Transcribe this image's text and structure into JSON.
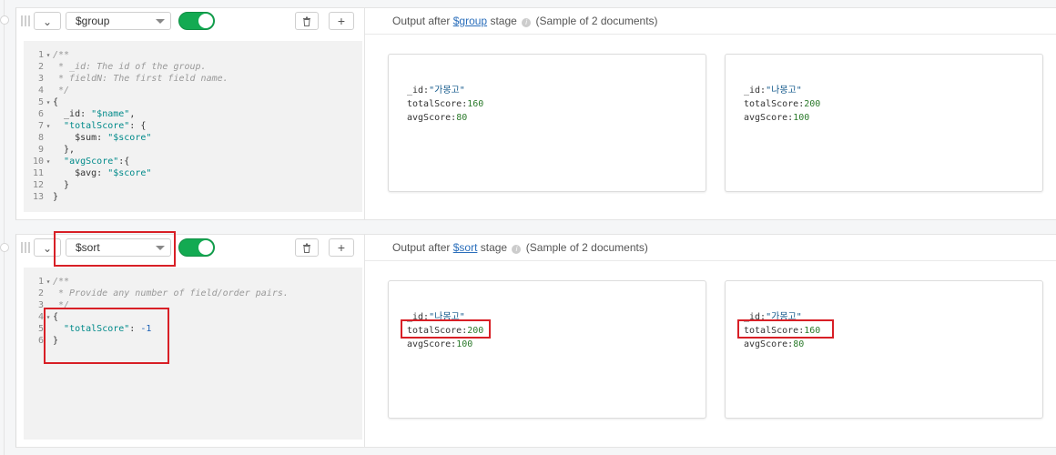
{
  "stages": [
    {
      "operator": "$group",
      "enabled": true,
      "collapse_icon": "chevron-down-icon",
      "delete_icon": "trash-icon",
      "add_label": "+",
      "output_header": {
        "prefix": "Output after",
        "link": "$group",
        "suffix": "stage",
        "sample": "(Sample of 2 documents)"
      },
      "code": [
        {
          "n": "1",
          "fold": true,
          "text": "/**",
          "type": "comment"
        },
        {
          "n": "2",
          "text": " * _id: The id of the group.",
          "type": "comment"
        },
        {
          "n": "3",
          "text": " * fieldN: The first field name.",
          "type": "comment"
        },
        {
          "n": "4",
          "text": " */",
          "type": "comment"
        },
        {
          "n": "5",
          "fold": true,
          "text": "{",
          "type": "punct"
        },
        {
          "n": "6",
          "text": "  _id: ",
          "tail": "\"$name\"",
          "after": ",",
          "type": "kv"
        },
        {
          "n": "7",
          "fold": true,
          "text": "  ",
          "key": "\"totalScore\"",
          "after": ": {",
          "type": "key"
        },
        {
          "n": "8",
          "text": "    $sum: ",
          "tail": "\"$score\"",
          "type": "kv"
        },
        {
          "n": "9",
          "text": "  },",
          "type": "punct"
        },
        {
          "n": "10",
          "fold": true,
          "text": "  ",
          "key": "\"avgScore\"",
          "after": ":{",
          "type": "key"
        },
        {
          "n": "11",
          "text": "    $avg: ",
          "tail": "\"$score\"",
          "type": "kv"
        },
        {
          "n": "12",
          "text": "  }",
          "type": "punct"
        },
        {
          "n": "13",
          "text": "}",
          "type": "punct"
        }
      ],
      "documents": [
        {
          "id": "\"가몽고\"",
          "totalScore": "160",
          "avgScore": "80"
        },
        {
          "id": "\"나몽고\"",
          "totalScore": "200",
          "avgScore": "100"
        }
      ]
    },
    {
      "operator": "$sort",
      "enabled": true,
      "collapse_icon": "chevron-down-icon",
      "delete_icon": "trash-icon",
      "add_label": "+",
      "output_header": {
        "prefix": "Output after",
        "link": "$sort",
        "suffix": "stage",
        "sample": "(Sample of 2 documents)"
      },
      "code": [
        {
          "n": "1",
          "fold": true,
          "text": "/**",
          "type": "comment"
        },
        {
          "n": "2",
          "text": " * Provide any number of field/order pairs.",
          "type": "comment"
        },
        {
          "n": "3",
          "text": " */",
          "type": "comment"
        },
        {
          "n": "4",
          "fold": true,
          "text": "{",
          "type": "punct"
        },
        {
          "n": "5",
          "text": "  ",
          "key": "\"totalScore\"",
          "after": ": ",
          "num": "-1",
          "type": "key"
        },
        {
          "n": "6",
          "text": "}",
          "type": "punct"
        }
      ],
      "documents": [
        {
          "id": "\"나몽고\"",
          "totalScore": "200",
          "avgScore": "100"
        },
        {
          "id": "\"가몽고\"",
          "totalScore": "160",
          "avgScore": "80"
        }
      ]
    }
  ],
  "field_labels": {
    "id": "_id:",
    "totalScore": "totalScore:",
    "avgScore": "avgScore:"
  },
  "colors": {
    "toggle_on": "#13aa52",
    "highlight": "#d81f26",
    "link": "#2a6ebb"
  }
}
